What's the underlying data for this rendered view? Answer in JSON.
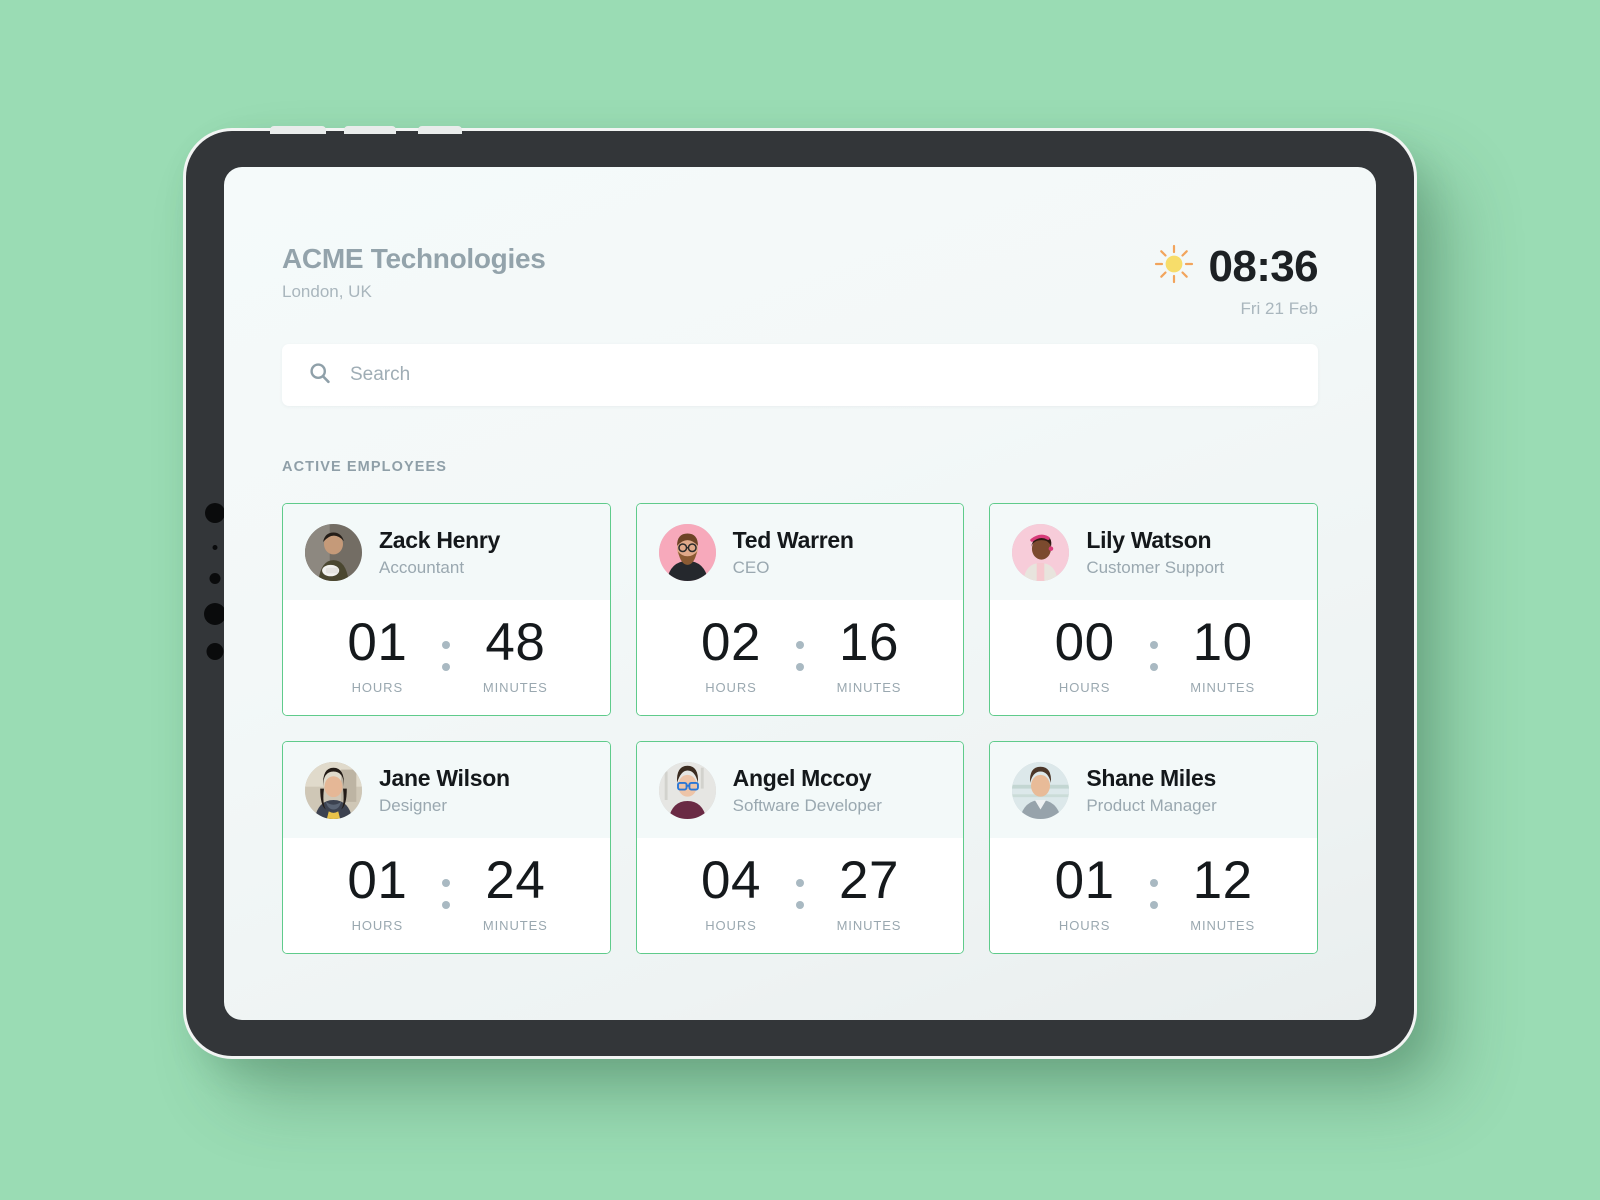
{
  "theme": {
    "page_background": "#9adcb4",
    "card_border": "#5fcb8b",
    "card_header_bg": "#f3f9f9",
    "accent_text": "#93a3ab",
    "sun_body": "#f7dd6a",
    "sun_rays": "#f0a濃"
  },
  "header": {
    "company": "ACME Technologies",
    "location": "London, UK",
    "weather_icon": "sun-icon",
    "time": "08:36",
    "date": "Fri 21 Feb"
  },
  "search": {
    "icon": "search-icon",
    "value": "",
    "placeholder": "Search"
  },
  "section": {
    "label": "ACTIVE EMPLOYEES"
  },
  "labels": {
    "hours": "HOURS",
    "minutes": "MINUTES"
  },
  "employees": [
    {
      "name": "Zack Henry",
      "role": "Accountant",
      "hours": "01",
      "minutes": "48",
      "avatar": "photo-zack-henry",
      "avatar_bg": "#6f6a63"
    },
    {
      "name": "Ted Warren",
      "role": "CEO",
      "hours": "02",
      "minutes": "16",
      "avatar": "photo-ted-warren",
      "avatar_bg": "#f7a9bb"
    },
    {
      "name": "Lily Watson",
      "role": "Customer Support",
      "hours": "00",
      "minutes": "10",
      "avatar": "photo-lily-watson",
      "avatar_bg": "#f7ccd9"
    },
    {
      "name": "Jane Wilson",
      "role": "Designer",
      "hours": "01",
      "minutes": "24",
      "avatar": "photo-jane-wilson",
      "avatar_bg": "#c6bfb2"
    },
    {
      "name": "Angel Mccoy",
      "role": "Software Developer",
      "hours": "04",
      "minutes": "27",
      "avatar": "photo-angel-mccoy",
      "avatar_bg": "#e3e3e1"
    },
    {
      "name": "Shane Miles",
      "role": "Product Manager",
      "hours": "01",
      "minutes": "12",
      "avatar": "photo-shane-miles",
      "avatar_bg": "#cdd9de"
    }
  ]
}
